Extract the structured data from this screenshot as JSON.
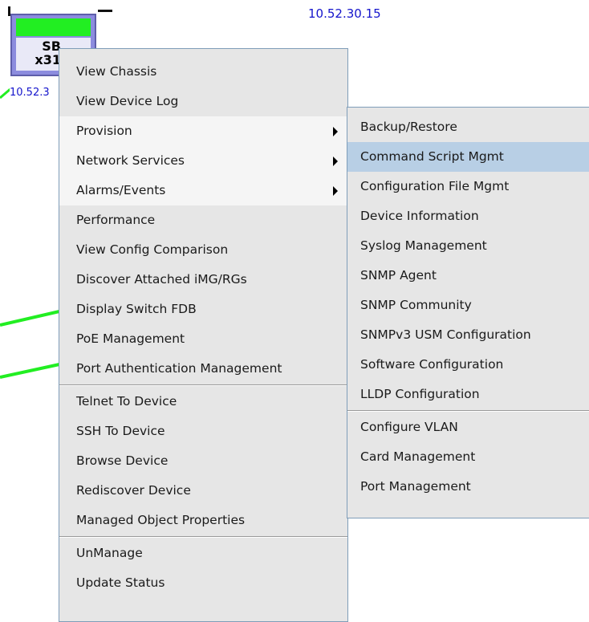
{
  "canvas": {
    "top_ip_label": "10.52.30.15",
    "node": {
      "line1": "SB",
      "line2": "x31",
      "ip_label": "10.52.3"
    },
    "colors": {
      "link": "#22ee22",
      "node_frame": "#8c8cde",
      "ip_text": "#1515cc"
    }
  },
  "context_menu": {
    "items": [
      {
        "label": "View Chassis"
      },
      {
        "label": "View Device Log"
      },
      {
        "label": "Provision",
        "submenu": true
      },
      {
        "label": "Network Services",
        "submenu": true
      },
      {
        "label": "Alarms/Events",
        "submenu": true
      },
      {
        "label": "Performance"
      },
      {
        "label": "View Config Comparison"
      },
      {
        "label": "Discover Attached iMG/RGs"
      },
      {
        "label": "Display Switch FDB"
      },
      {
        "label": "PoE Management"
      },
      {
        "label": "Port Authentication Management"
      },
      {
        "label": "Telnet To Device"
      },
      {
        "label": "SSH To Device"
      },
      {
        "label": "Browse Device"
      },
      {
        "label": "Rediscover Device"
      },
      {
        "label": "Managed Object Properties"
      },
      {
        "label": "UnManage"
      },
      {
        "label": "Update Status"
      }
    ]
  },
  "provision_submenu": {
    "items": [
      {
        "label": "Backup/Restore"
      },
      {
        "label": "Command Script Mgmt"
      },
      {
        "label": "Configuration File Mgmt"
      },
      {
        "label": "Device Information"
      },
      {
        "label": "Syslog Management"
      },
      {
        "label": "SNMP Agent"
      },
      {
        "label": "SNMP Community"
      },
      {
        "label": "SNMPv3 USM Configuration"
      },
      {
        "label": "Software Configuration"
      },
      {
        "label": "LLDP Configuration"
      },
      {
        "label": "Configure VLAN"
      },
      {
        "label": "Card Management"
      },
      {
        "label": "Port Management"
      }
    ]
  },
  "colors": {
    "menu_bg": "#e6e6e6",
    "menu_border": "#7f9db9",
    "highlight": "#b8cfe5"
  }
}
